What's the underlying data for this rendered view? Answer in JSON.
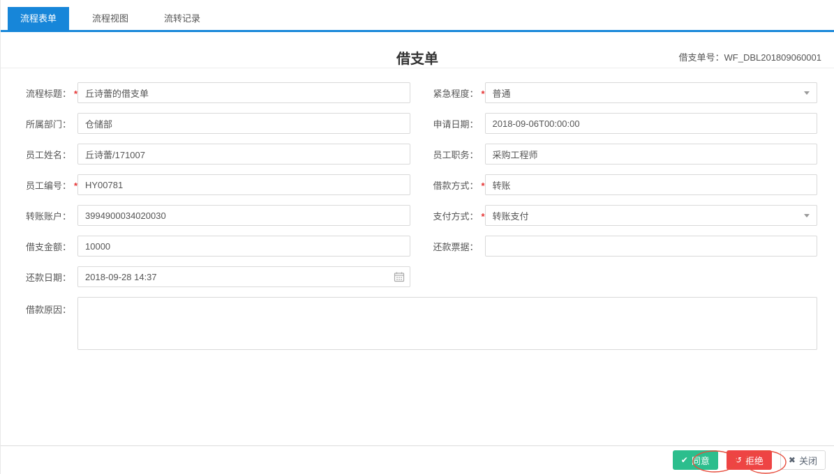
{
  "tabs": {
    "items": [
      {
        "label": "流程表单"
      },
      {
        "label": "流程视图"
      },
      {
        "label": "流转记录"
      }
    ],
    "active_index": 0
  },
  "header": {
    "title": "借支单",
    "doc_no_label": "借支单号：",
    "doc_no": "WF_DBL201809060001"
  },
  "form": {
    "fields": [
      {
        "label": "流程标题：",
        "required_mark": "*",
        "value": "丘诗蕾的借支单",
        "type": "text"
      },
      {
        "label": "紧急程度：",
        "required_mark": "*",
        "value": "普通",
        "type": "select"
      },
      {
        "label": "所属部门：",
        "value": "仓储部",
        "type": "text"
      },
      {
        "label": "申请日期：",
        "value": "2018-09-06T00:00:00",
        "type": "text"
      },
      {
        "label": "员工姓名：",
        "value": "丘诗蕾/171007",
        "type": "text"
      },
      {
        "label": "员工职务：",
        "value": "采购工程师",
        "type": "text"
      },
      {
        "label": "员工编号：",
        "required_mark": "*",
        "value": "HY00781",
        "type": "text"
      },
      {
        "label": "借款方式：",
        "required_mark": "*",
        "value": "转账",
        "type": "text"
      },
      {
        "label": "转账账户：",
        "value": "3994900034020030",
        "type": "text"
      },
      {
        "label": "支付方式：",
        "required_mark": "*",
        "value": "转账支付",
        "type": "select"
      },
      {
        "label": "借支金额：",
        "value": "10000",
        "type": "text"
      },
      {
        "label": "还款票据：",
        "value": "",
        "type": "text"
      },
      {
        "label": "还款日期：",
        "value": "2018-09-28 14:37",
        "type": "date"
      },
      {
        "label": "借款原因：",
        "value": "",
        "type": "textarea"
      }
    ]
  },
  "footer": {
    "approve_label": "同意",
    "reject_label": "拒绝",
    "close_label": "关闭",
    "approve_icon": "✔",
    "reject_icon": "↺",
    "close_icon": "✖"
  },
  "colors": {
    "accent_blue": "#1786d9",
    "approve_green": "#2cbe8d",
    "reject_red": "#ee4444",
    "required_red": "#e53333",
    "annotation_red": "#e74c3c",
    "input_border": "#d9d9d9"
  }
}
